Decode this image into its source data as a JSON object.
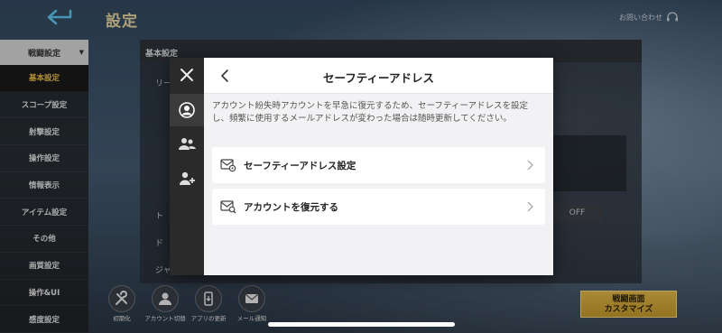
{
  "app": {
    "page_title": "設定",
    "support_link": "お問い合わせ"
  },
  "sidebar": {
    "category": "戦闘設定",
    "items": [
      {
        "label": "基本設定",
        "active": true
      },
      {
        "label": "スコープ設定",
        "active": false
      },
      {
        "label": "射撃設定",
        "active": false
      },
      {
        "label": "操作設定",
        "active": false
      },
      {
        "label": "情報表示",
        "active": false
      },
      {
        "label": "アイテム設定",
        "active": false
      },
      {
        "label": "その他",
        "active": false
      },
      {
        "label": "画質設定",
        "active": false
      },
      {
        "label": "操作&UI",
        "active": false
      },
      {
        "label": "感度設定",
        "active": false
      }
    ]
  },
  "panel": {
    "title": "基本設定",
    "fragments": [
      "リー",
      "ト",
      "ド",
      "ジャ"
    ],
    "toggle_value": "OFF"
  },
  "bottom_tools": [
    {
      "label": "初期化",
      "icon": "wrench-icon"
    },
    {
      "label": "アカウント切替",
      "icon": "user-icon"
    },
    {
      "label": "アプリの更新",
      "icon": "phone-icon"
    },
    {
      "label": "メール通知",
      "icon": "mail-icon"
    }
  ],
  "customize_button": {
    "line1": "戦闘画面",
    "line2": "カスタマイズ"
  },
  "modal": {
    "title": "セーフティーアドレス",
    "description": "アカウント紛失時アカウントを早急に復元するため、セーフティーアドレスを設定し、頻繁に使用するメールアドレスが変わった場合は随時更新してください。",
    "rail_tabs": [
      {
        "icon": "account-icon",
        "active": true
      },
      {
        "icon": "friends-icon",
        "active": false
      },
      {
        "icon": "add-user-icon",
        "active": false
      }
    ],
    "options": [
      {
        "label": "セーフティーアドレス設定",
        "icon": "mail-settings-icon"
      },
      {
        "label": "アカウントを復元する",
        "icon": "mail-search-icon"
      }
    ]
  },
  "colors": {
    "accent_gold": "#f0c24b",
    "modal_bg": "#f2f2f4",
    "rail_bg": "#2a2a2a"
  }
}
